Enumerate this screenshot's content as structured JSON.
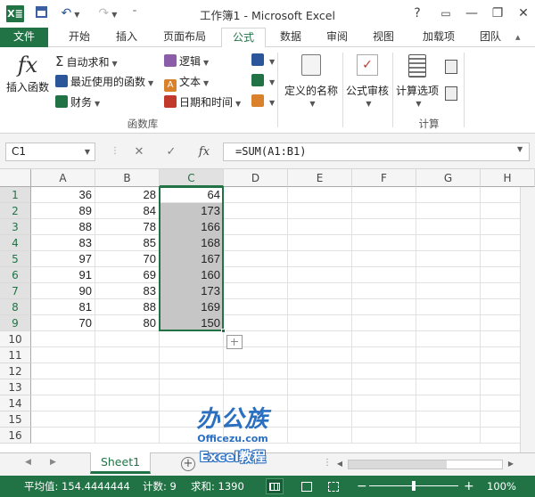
{
  "window": {
    "title": "工作簿1 - Microsoft Excel",
    "help": "?",
    "minimize": "—",
    "restore": "❐",
    "close": "✕"
  },
  "tabs": [
    "文件",
    "开始",
    "插入",
    "页面布局",
    "公式",
    "数据",
    "审阅",
    "视图",
    "加载项",
    "团队"
  ],
  "ribbon": {
    "insert_function": "插入函数",
    "autosum": "自动求和",
    "recent": "最近使用的函数",
    "financial": "财务",
    "logical": "逻辑",
    "text": "文本",
    "datetime": "日期和时间",
    "group_library": "函数库",
    "defined_names": "定义的名称",
    "formula_auditing": "公式审核",
    "calc_options": "计算选项",
    "group_calc": "计算"
  },
  "formula_bar": {
    "name_box": "C1",
    "formula": "=SUM(A1:B1)"
  },
  "columns": [
    "A",
    "B",
    "C",
    "D",
    "E",
    "F",
    "G",
    "H"
  ],
  "rows": [
    "1",
    "2",
    "3",
    "4",
    "5",
    "6",
    "7",
    "8",
    "9",
    "10",
    "11",
    "12",
    "13",
    "14",
    "15",
    "16"
  ],
  "cells": {
    "A": [
      "36",
      "89",
      "88",
      "83",
      "97",
      "91",
      "90",
      "81",
      "70"
    ],
    "B": [
      "28",
      "84",
      "78",
      "85",
      "70",
      "69",
      "83",
      "88",
      "80"
    ],
    "C": [
      "64",
      "173",
      "166",
      "168",
      "167",
      "160",
      "173",
      "169",
      "150"
    ]
  },
  "sheet": {
    "tab": "Sheet1",
    "add": "+"
  },
  "status": {
    "average": "平均值: 154.4444444",
    "count": "计数: 9",
    "sum": "求和: 1390",
    "zoom": "100%"
  },
  "watermark": {
    "brand": "办公族",
    "site": "Officezu.com",
    "caption": "Excel教程"
  },
  "colors": {
    "accent": "#217346",
    "selection": "#c6c6c6"
  }
}
